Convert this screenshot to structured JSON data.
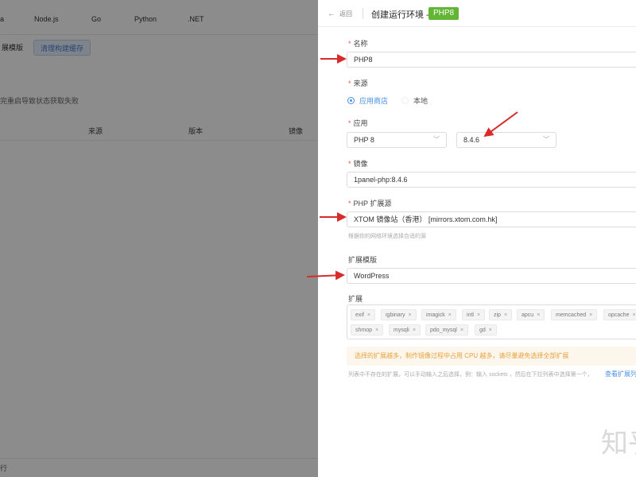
{
  "background": {
    "tabs": [
      "a",
      "Node.js",
      "Go",
      "Python",
      ".NET"
    ],
    "buttons": {
      "mode": "展模版",
      "clear_cache": "清理构建缓存"
    },
    "notice": "完重启导致状态获取失败",
    "table_headers": [
      "来源",
      "版本",
      "镜像"
    ],
    "footer": "行"
  },
  "drawer": {
    "back_label": "返回",
    "title": "创建运行环境 -",
    "badge": "PHP8",
    "name": {
      "label": "名称",
      "value": "PHP8"
    },
    "source": {
      "label": "来源",
      "options": [
        "应用商店",
        "本地"
      ],
      "selected": "应用商店"
    },
    "app": {
      "label": "应用",
      "app_value": "PHP 8",
      "version_value": "8.4.6"
    },
    "image": {
      "label": "镜像",
      "value": "1panel-php:8.4.6"
    },
    "ext_source": {
      "label": "PHP 扩展源",
      "value": "XTOM 镜像站（香港） [mirrors.xtom.com.hk]",
      "hint": "根据你的网络环境选择合适的源"
    },
    "ext_template": {
      "label": "扩展模版",
      "value": "WordPress"
    },
    "extensions": {
      "label": "扩展",
      "tags_row1": [
        "exif",
        "igbinary",
        "imagick",
        "intl",
        "zip",
        "apcu",
        "memcached",
        "opcache"
      ],
      "tags_row2": [
        "shmop",
        "mysqli",
        "pdo_mysql",
        "gd"
      ]
    },
    "warning": "选择的扩展越多，制作镜像过程中占用 CPU 越多，请尽量避免选择全部扩展",
    "tip": "列表中不存在的扩展，可以手动输入之后选择，例：输入 sockets ，然后在下拉列表中选择第一个，",
    "tip_link": "查看扩展列",
    "watermark": "知乎"
  },
  "colors": {
    "accent": "#4a90e2",
    "badge": "#62b633",
    "annotation_arrow": "#d92b2b",
    "warning_bg": "#fdf6ec",
    "warning_text": "#e6a23c"
  }
}
